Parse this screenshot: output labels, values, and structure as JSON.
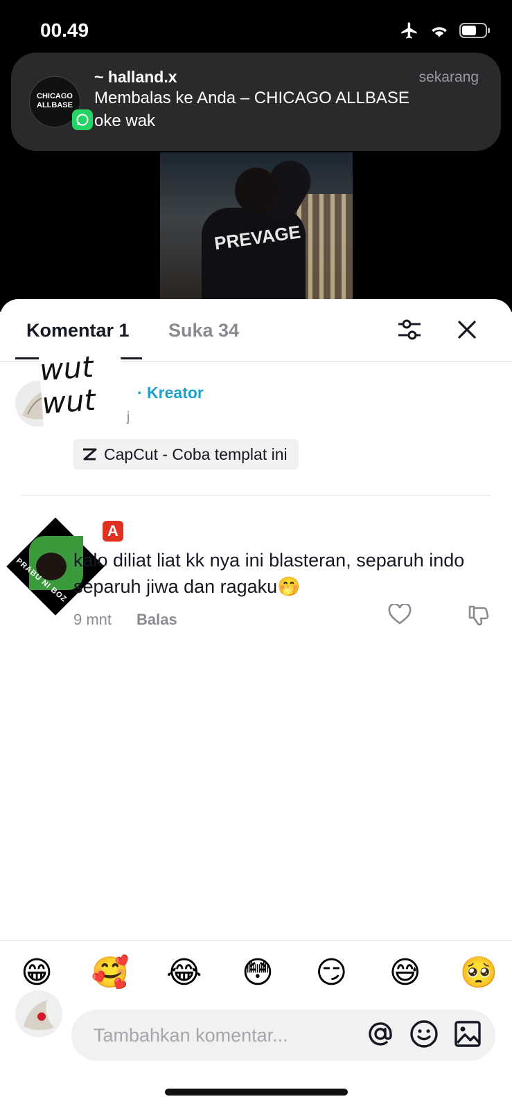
{
  "status_bar": {
    "time": "00.49"
  },
  "notification": {
    "avatar_text": "CHICAGO ALLBASE",
    "sender": "~ halland.x",
    "time": "sekarang",
    "title": "Membalas ke Anda – CHICAGO ALLBASE",
    "body": "oke wak"
  },
  "video": {
    "hoodie_text": "PREVAGE"
  },
  "sheet": {
    "tabs": [
      {
        "label": "Komentar 1",
        "active": true
      },
      {
        "label": "Suka 34",
        "active": false
      }
    ]
  },
  "creator_comment": {
    "sticker_text": "wut wut",
    "creator_label": "· Kreator",
    "suffix": "j",
    "capcut_label": "CapCut - Coba templat ini"
  },
  "comment": {
    "sticker_caption": "PRABU NI BOZ",
    "badge": "A",
    "text": "kalo diliat liat kk nya ini blasteran, separuh indo separuh jiwa dan ragaku🤭",
    "time": "9 mnt",
    "reply_label": "Balas"
  },
  "emoji_bar": [
    "😁",
    "🥰",
    "😂",
    "😳",
    "😏",
    "😅",
    "🥺"
  ],
  "input": {
    "placeholder": "Tambahkan komentar...",
    "icons": [
      "at-icon",
      "smiley-icon",
      "image-icon"
    ]
  },
  "colors": {
    "accent_creator": "#1da1c8",
    "text_primary": "#161823",
    "text_secondary": "#8a8b91"
  }
}
